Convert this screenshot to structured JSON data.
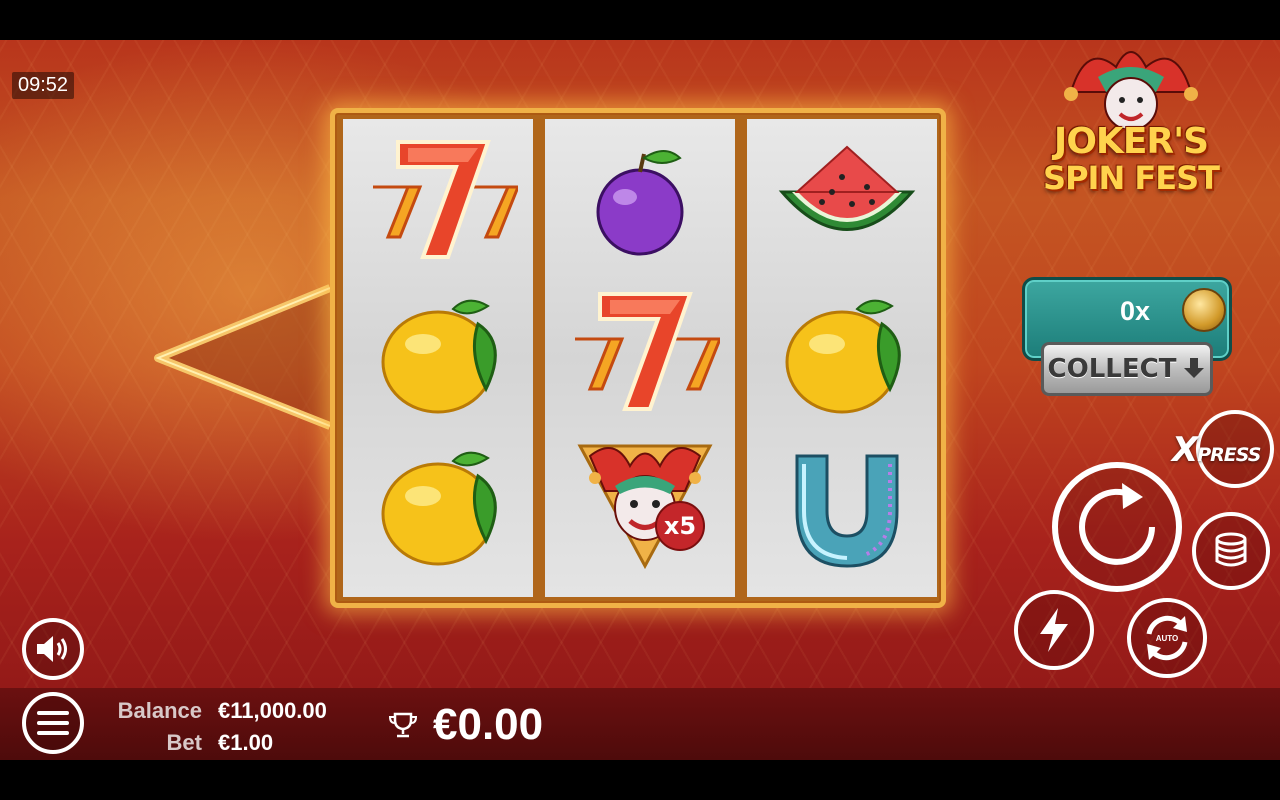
{
  "status": {
    "clock": "09:52"
  },
  "game": {
    "title_line1": "JOKER'S",
    "title_line2": "SPIN FEST"
  },
  "reels": [
    [
      "seven-777-icon",
      "lemon-icon",
      "lemon-icon"
    ],
    [
      "plum-icon",
      "seven-777-icon",
      "joker-x5-icon"
    ],
    [
      "watermelon-icon",
      "lemon-icon",
      "horseshoe-icon"
    ]
  ],
  "joker_multiplier_badge": "x5",
  "collect_panel": {
    "multiplier": "0x",
    "collect_label": "COLLECT"
  },
  "xpress": {
    "x": "X",
    "rest": "PRESS"
  },
  "controls": {
    "auto_label": "AUTO"
  },
  "account": {
    "balance_label": "Balance",
    "balance_value": "€11,000.00",
    "bet_label": "Bet",
    "bet_value": "€1.00",
    "win_value": "€0.00"
  },
  "colors": {
    "frame_gold": "#f0b247",
    "panel_teal": "#2a8f8a",
    "bg_red": "#a8221c"
  }
}
